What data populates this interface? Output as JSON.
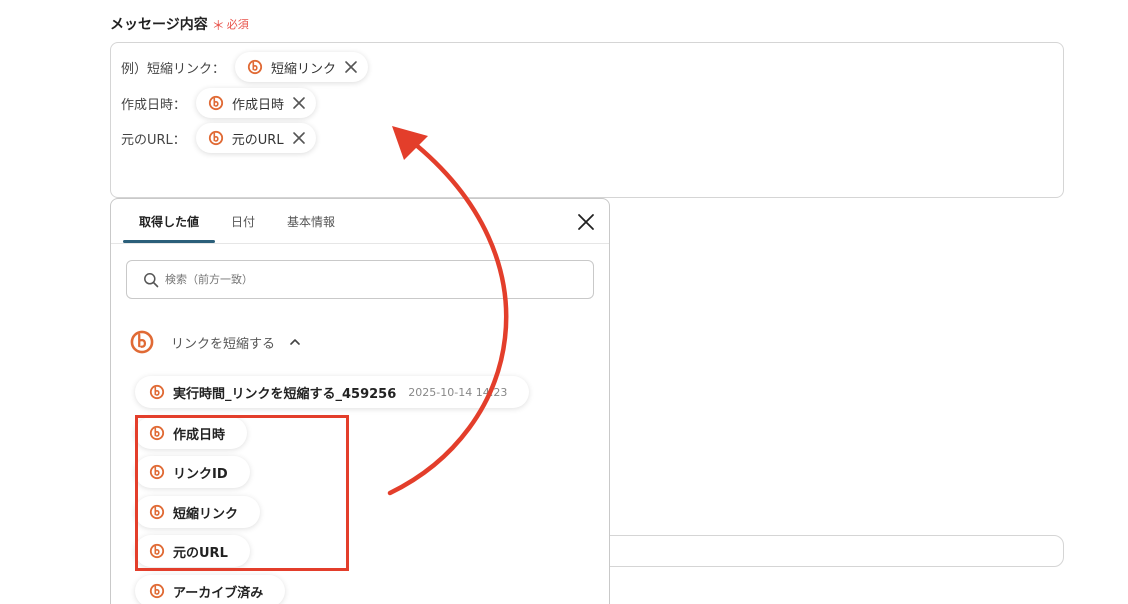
{
  "field": {
    "label": "メッセージ内容",
    "required_mark": "＊",
    "required_text": "必須"
  },
  "message": {
    "lines": [
      {
        "label": "例）短縮リンク：",
        "chip": "短縮リンク"
      },
      {
        "label": "作成日時：",
        "chip": "作成日時"
      },
      {
        "label": "元のURL：",
        "chip": "元のURL"
      }
    ]
  },
  "panel": {
    "tabs": [
      {
        "label": "取得した値",
        "active": true
      },
      {
        "label": "日付",
        "active": false
      },
      {
        "label": "基本情報",
        "active": false
      }
    ],
    "search": {
      "placeholder": "検索（前方一致）"
    },
    "group": {
      "title": "リンクを短縮する"
    },
    "items": [
      {
        "label": "実行時間_リンクを短縮する_459256",
        "timestamp": "2025-10-14 14:23"
      },
      {
        "label": "作成日時"
      },
      {
        "label": "リンクID"
      },
      {
        "label": "短縮リンク"
      },
      {
        "label": "元のURL"
      },
      {
        "label": "アーカイブ済み"
      }
    ]
  },
  "colors": {
    "accent": "#e06a35",
    "highlight": "#e33e2b",
    "tab_underline": "#2b5f7a",
    "required": "#e8524a"
  },
  "icons": {
    "service": "bitly-b-icon",
    "close": "close-icon",
    "search": "search-icon",
    "collapse": "chevron-up-icon"
  }
}
